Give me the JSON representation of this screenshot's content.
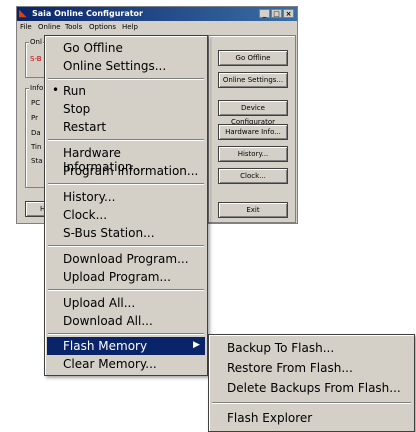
{
  "window": {
    "title": "Saia Online Configurator",
    "caption_buttons": [
      "_",
      "□",
      "×"
    ]
  },
  "menubar": [
    "File",
    "Online",
    "Tools",
    "Options",
    "Help"
  ],
  "left_panel": {
    "group1_label": "Onl",
    "group1_value": "S-B",
    "group2_label": "Info",
    "info_rows": [
      "PC",
      "Pr",
      "Da",
      "Tin",
      "Sta"
    ],
    "partial_button": "H"
  },
  "buttons": [
    "Go Offline",
    "Online Settings...",
    "Device Configurator",
    "Hardware Info...",
    "History...",
    "Clock...",
    "Exit"
  ],
  "menu": {
    "items": [
      {
        "label": "Go Offline"
      },
      {
        "label": "Online Settings..."
      },
      {
        "label": "Run",
        "bullet": "•"
      },
      {
        "label": "Stop"
      },
      {
        "label": "Restart"
      },
      {
        "label": "Hardware Information..."
      },
      {
        "label": "Program Information..."
      },
      {
        "label": "History..."
      },
      {
        "label": "Clock..."
      },
      {
        "label": "S-Bus Station..."
      },
      {
        "label": "Download Program..."
      },
      {
        "label": "Upload Program..."
      },
      {
        "label": "Upload All..."
      },
      {
        "label": "Download All..."
      },
      {
        "label": "Flash Memory",
        "arrow": "▶",
        "highlighted": true
      },
      {
        "label": "Clear Memory..."
      }
    ]
  },
  "submenu": {
    "items": [
      {
        "label": "Backup To Flash..."
      },
      {
        "label": "Restore From Flash..."
      },
      {
        "label": "Delete Backups From Flash..."
      },
      {
        "label": "Flash Explorer"
      }
    ]
  },
  "colors": {
    "highlight": "#0a246a",
    "face": "#d4d0c8"
  }
}
